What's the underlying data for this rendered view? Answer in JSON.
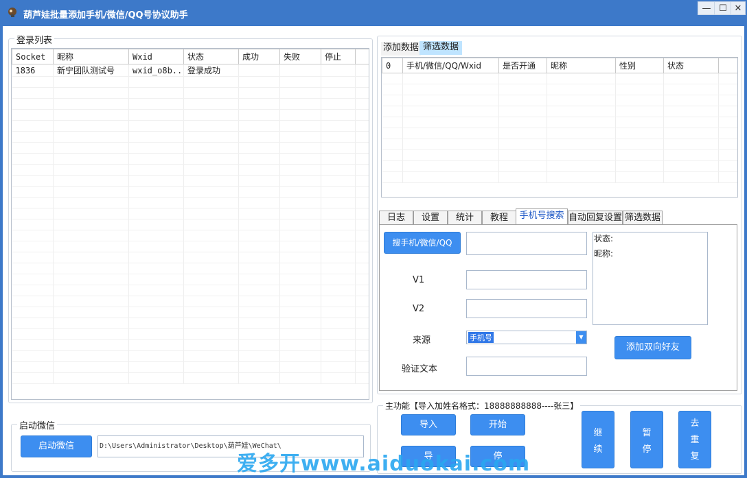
{
  "window": {
    "title": "葫芦娃批量添加手机/微信/QQ号协议助手",
    "min_icon": "minimize-icon",
    "max_icon": "maximize-icon",
    "close_icon": "close-icon"
  },
  "login_list": {
    "legend": "登录列表",
    "columns": [
      "Socket",
      "昵称",
      "Wxid",
      "状态",
      "成功",
      "失败",
      "停止"
    ],
    "rows": [
      [
        "1836",
        "新宁团队测试号",
        "wxid_o8b...",
        "登录成功",
        "",
        "",
        ""
      ]
    ]
  },
  "data_tabs": {
    "tabs": [
      "添加数据",
      "筛选数据"
    ],
    "columns": [
      "0",
      "手机/微信/QQ/Wxid",
      "是否开通",
      "昵称",
      "性别",
      "状态"
    ]
  },
  "bottom_tabs": [
    "日志",
    "设置",
    "统计",
    "教程",
    "手机号搜索",
    "自动回复设置",
    "筛选数据"
  ],
  "search_panel": {
    "search_button": "搜手机/微信/QQ",
    "search_value": "",
    "status_label": "状态:",
    "nickname_label": "昵称:",
    "v1_label": "V1",
    "v1_value": "",
    "v2_label": "V2",
    "v2_value": "",
    "source_label": "来源",
    "source_selected": "手机号",
    "verify_label": "验证文本",
    "verify_value": "",
    "add_friend_button": "添加双向好友"
  },
  "launch": {
    "legend": "启动微信",
    "button": "启动微信",
    "path": "D:\\Users\\Administrator\\Desktop\\葫芦娃\\WeChat\\"
  },
  "main_function": {
    "legend": "主功能【导入加姓名格式：18888888888----张三】",
    "import_button": "导入",
    "start_button": "开始",
    "export_button": "导",
    "stop_button": "停",
    "continue_button": [
      "继",
      "续"
    ],
    "pause_button": [
      "暂",
      "停"
    ],
    "dedup_button": [
      "去",
      "重",
      "复"
    ]
  },
  "watermark": "爱多开www.aiduokai.com",
  "colors": {
    "titlebar": "#3d79c9",
    "button": "#3d8ef0",
    "active_tab_text": "#1a56c6"
  }
}
